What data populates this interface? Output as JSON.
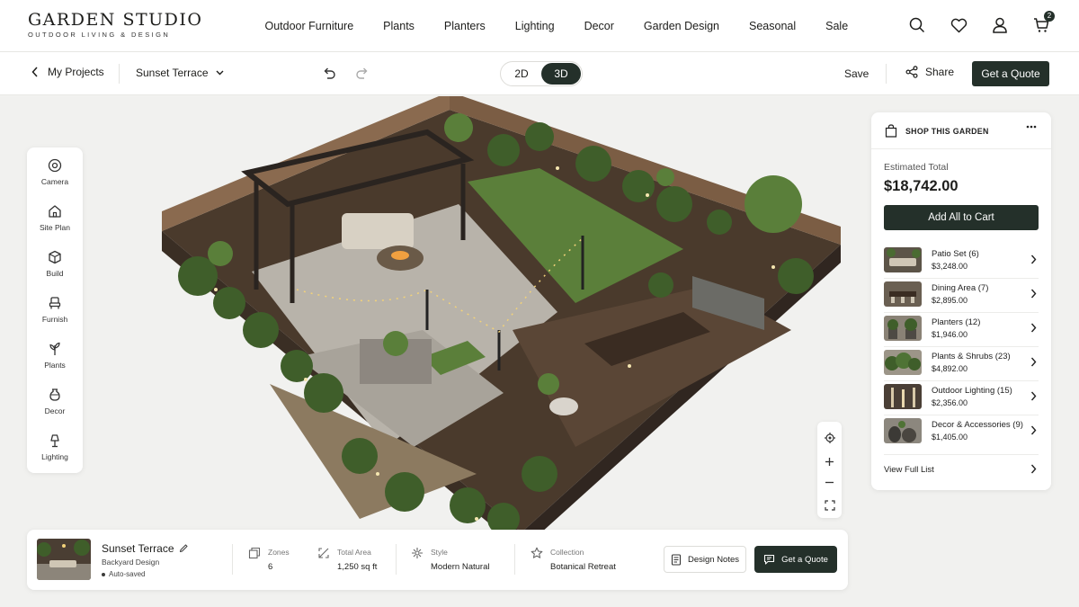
{
  "brand": {
    "name": "GARDEN STUDIO",
    "tagline": "OUTDOOR LIVING & DESIGN"
  },
  "nav": {
    "items": [
      "Outdoor Furniture",
      "Plants",
      "Planters",
      "Lighting",
      "Decor",
      "Garden Design",
      "Seasonal",
      "Sale"
    ]
  },
  "header_icons": {
    "search": "search-icon",
    "wishlist": "heart-icon",
    "account": "user-icon",
    "cart": "cart-icon",
    "cart_count": "2"
  },
  "toolbar": {
    "back_label": "My Projects",
    "project_name": "Sunset Terrace",
    "view_2d": "2D",
    "view_3d": "3D",
    "active_view": "3D",
    "save_label": "Save",
    "share_label": "Share",
    "quote_label": "Get a Quote"
  },
  "tools": [
    {
      "label": "Camera",
      "icon": "camera-icon"
    },
    {
      "label": "Site Plan",
      "icon": "home-icon"
    },
    {
      "label": "Build",
      "icon": "cube-icon"
    },
    {
      "label": "Furnish",
      "icon": "chair-icon"
    },
    {
      "label": "Plants",
      "icon": "plant-icon"
    },
    {
      "label": "Decor",
      "icon": "vase-icon"
    },
    {
      "label": "Lighting",
      "icon": "lamp-icon"
    }
  ],
  "shop": {
    "title": "SHOP THIS GARDEN",
    "estimated_label": "Estimated Total",
    "estimated_total": "$18,742.00",
    "add_all_label": "Add All to Cart",
    "items": [
      {
        "name": "Patio Set (6)",
        "price": "$3,248.00"
      },
      {
        "name": "Dining Area (7)",
        "price": "$2,895.00"
      },
      {
        "name": "Planters (12)",
        "price": "$1,946.00"
      },
      {
        "name": "Plants & Shrubs (23)",
        "price": "$4,892.00"
      },
      {
        "name": "Outdoor Lighting (15)",
        "price": "$2,356.00"
      },
      {
        "name": "Decor & Accessories (9)",
        "price": "$1,405.00"
      }
    ],
    "view_full_label": "View Full List"
  },
  "project_info": {
    "title": "Sunset Terrace",
    "subtitle": "Backyard Design",
    "status": "Auto-saved",
    "stats": [
      {
        "label": "Zones",
        "value": "6"
      },
      {
        "label": "Total Area",
        "value": "1,250 sq ft"
      },
      {
        "label": "Style",
        "value": "Modern Natural"
      },
      {
        "label": "Collection",
        "value": "Botanical Retreat"
      }
    ],
    "notes_label": "Design Notes",
    "quote_label": "Get a Quote"
  },
  "colors": {
    "accent": "#24302a",
    "background": "#f1f1ef",
    "lawn": "#5b7f3a",
    "paving": "#b8b3aa",
    "deck": "#5a4636",
    "fence": "#8a6a4f"
  }
}
